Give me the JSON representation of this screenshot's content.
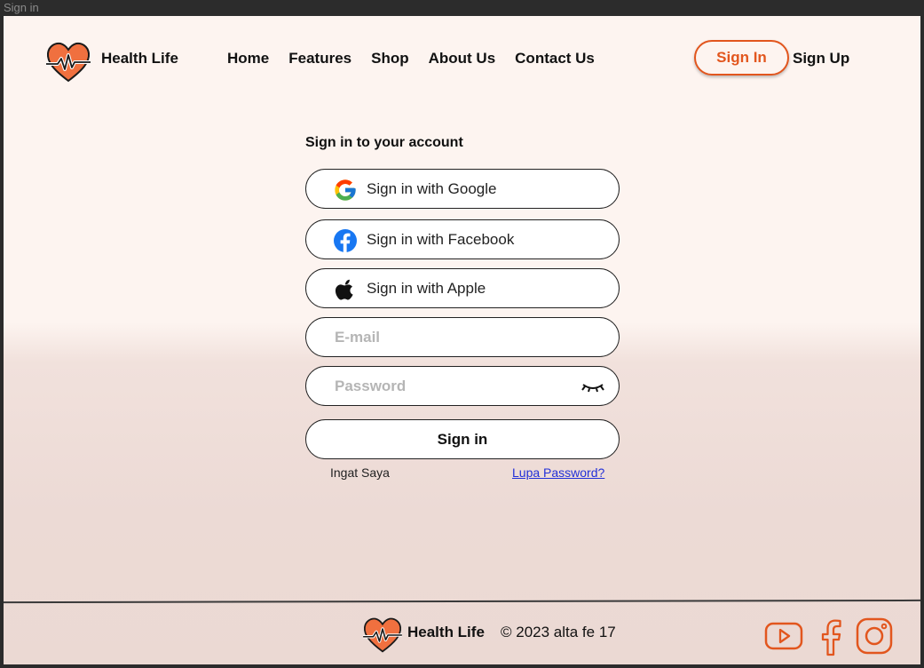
{
  "window": {
    "title": "Sign in"
  },
  "header": {
    "brand": "Health Life",
    "nav": [
      "Home",
      "Features",
      "Shop",
      "About Us",
      "Contact Us"
    ],
    "signin_label": "Sign In",
    "signup_label": "Sign Up"
  },
  "form": {
    "title": "Sign in to your account",
    "google_label": "Sign in with Google",
    "facebook_label": "Sign in with Facebook",
    "apple_label": "Sign in with Apple",
    "email_placeholder": "E-mail",
    "password_placeholder": "Password",
    "submit_label": "Sign in",
    "remember_label": "Ingat Saya",
    "forgot_label": "Lupa Password?"
  },
  "footer": {
    "brand": "Health Life",
    "copyright": "© 2023 alta fe 17",
    "social_icons": [
      "youtube-icon",
      "facebook-icon",
      "instagram-icon"
    ]
  },
  "colors": {
    "accent": "#e2561e",
    "logo_heart": "#f0703f",
    "link": "#2230d8",
    "background_top": "#fdf4f0",
    "background_bottom": "#ebd9d3"
  }
}
